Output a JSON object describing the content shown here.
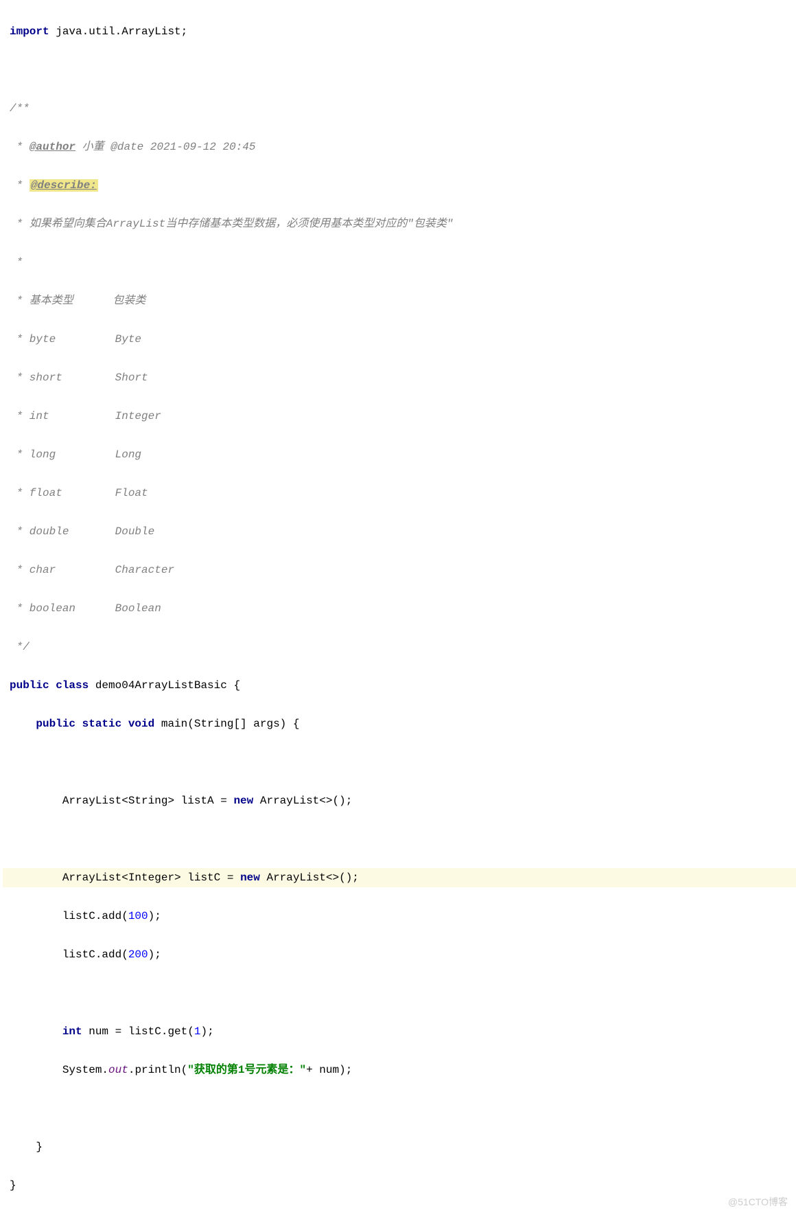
{
  "code": {
    "l1a": "import",
    "l1b": " java.util.ArrayList;",
    "blank": "",
    "l3": "/**",
    "l4a": " * ",
    "l4tag": "@author",
    "l4b": " 小董 @date 2021-09-12 20:45",
    "l5a": " * ",
    "l5tag": "@describe:",
    "l6": " * 如果希望向集合ArrayList当中存储基本类型数据，必须使用基本类型对应的\"包装类\"",
    "l7": " *",
    "l8": " * 基本类型      包装类",
    "l9": " * byte         Byte",
    "l10": " * short        Short",
    "l11": " * int          Integer",
    "l12": " * long         Long",
    "l13": " * float        Float",
    "l14": " * double       Double",
    "l15": " * char         Character",
    "l16": " * boolean      Boolean",
    "l17": " */",
    "l18a": "public class",
    "l18b": " demo04ArrayListBasic {",
    "l19a": "    ",
    "l19b": "public static void",
    "l19c": " main(String[] args) {",
    "l21a": "        ArrayList<String> listA = ",
    "l21b": "new",
    "l21c": " ArrayList<>();",
    "l23a": "        ArrayList<Integer> listC = ",
    "l23b": "new",
    "l23c": " ArrayList<>();",
    "l24a": "        listC.add(",
    "l24b": "100",
    "l24c": ");",
    "l25a": "        listC.add(",
    "l25b": "200",
    "l25c": ");",
    "l27a": "        ",
    "l27b": "int",
    "l27c": " num = listC.get(",
    "l27d": "1",
    "l27e": ");",
    "l28a": "        System.",
    "l28b": "out",
    "l28c": ".println(",
    "l28d": "\"获取的第1号元素是：\"",
    "l28e": "+ num);",
    "l30": "    }",
    "l31": "}"
  },
  "watermark": "@51CTO博客"
}
